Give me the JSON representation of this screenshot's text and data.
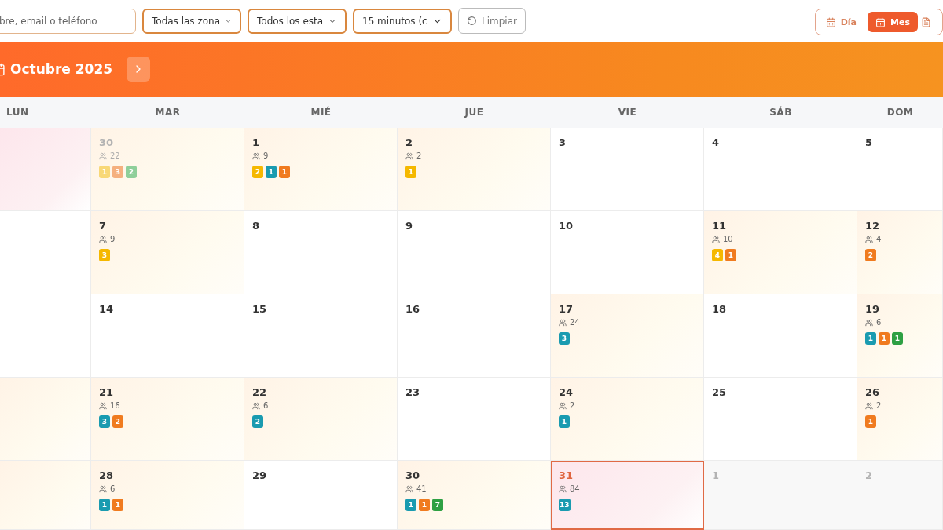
{
  "toolbar": {
    "search": {
      "placeholder": "bre, email o teléfono"
    },
    "selects": [
      {
        "value": "Todas las zona"
      },
      {
        "value": "Todos los esta"
      },
      {
        "value": "15 minutos (c"
      }
    ],
    "clear_button": "Limpiar",
    "views": [
      {
        "label": "Día",
        "selected": false
      },
      {
        "label": "Mes",
        "selected": true
      }
    ]
  },
  "month": {
    "title": "Octubre 2025"
  },
  "weekdays": [
    "LUN",
    "MAR",
    "MIÉ",
    "JUE",
    "VIE",
    "SÁB",
    "DOM"
  ],
  "weeks": [
    {
      "days": [
        {
          "kind": "pink"
        },
        {
          "day": "30",
          "outside": true,
          "kind": "warm",
          "count": "22",
          "badges": [
            {
              "n": "1",
              "color": "#f8d877"
            },
            {
              "n": "3",
              "color": "#f5b07f"
            },
            {
              "n": "2",
              "color": "#8fcf9a"
            }
          ]
        },
        {
          "day": "1",
          "kind": "warm",
          "count": "9",
          "badges": [
            {
              "n": "2",
              "color": "#f5b800"
            },
            {
              "n": "1",
              "color": "#1a9bb0"
            },
            {
              "n": "1",
              "color": "#f07b1f"
            }
          ]
        },
        {
          "day": "2",
          "kind": "warm",
          "count": "2",
          "badges": [
            {
              "n": "1",
              "color": "#f5b800"
            }
          ]
        },
        {
          "day": "3",
          "kind": "plain"
        },
        {
          "day": "4",
          "kind": "plain"
        },
        {
          "day": "5",
          "kind": "plain"
        }
      ]
    },
    {
      "days": [
        {
          "kind": "plain"
        },
        {
          "day": "7",
          "kind": "warm",
          "count": "9",
          "badges": [
            {
              "n": "3",
              "color": "#f5b800"
            }
          ]
        },
        {
          "day": "8",
          "kind": "plain"
        },
        {
          "day": "9",
          "kind": "plain"
        },
        {
          "day": "10",
          "kind": "plain"
        },
        {
          "day": "11",
          "kind": "warm",
          "count": "10",
          "badges": [
            {
              "n": "4",
              "color": "#f5b800"
            },
            {
              "n": "1",
              "color": "#f07b1f"
            }
          ]
        },
        {
          "day": "12",
          "kind": "warm",
          "count": "4",
          "badges": [
            {
              "n": "2",
              "color": "#f07b1f"
            }
          ]
        }
      ]
    },
    {
      "days": [
        {
          "kind": "plain"
        },
        {
          "day": "14",
          "kind": "plain"
        },
        {
          "day": "15",
          "kind": "plain"
        },
        {
          "day": "16",
          "kind": "plain"
        },
        {
          "day": "17",
          "kind": "warm",
          "count": "24",
          "badges": [
            {
              "n": "3",
              "color": "#1a9bb0"
            }
          ]
        },
        {
          "day": "18",
          "kind": "plain"
        },
        {
          "day": "19",
          "kind": "warm",
          "count": "6",
          "badges": [
            {
              "n": "1",
              "color": "#1a9bb0"
            },
            {
              "n": "1",
              "color": "#f07b1f"
            },
            {
              "n": "1",
              "color": "#2ea043"
            }
          ]
        }
      ]
    },
    {
      "days": [
        {
          "kind": "warm"
        },
        {
          "day": "21",
          "kind": "warm",
          "count": "16",
          "badges": [
            {
              "n": "3",
              "color": "#1a9bb0"
            },
            {
              "n": "2",
              "color": "#f07b1f"
            }
          ]
        },
        {
          "day": "22",
          "kind": "warm",
          "count": "6",
          "badges": [
            {
              "n": "2",
              "color": "#1a9bb0"
            }
          ]
        },
        {
          "day": "23",
          "kind": "plain"
        },
        {
          "day": "24",
          "kind": "warm",
          "count": "2",
          "badges": [
            {
              "n": "1",
              "color": "#1a9bb0"
            }
          ]
        },
        {
          "day": "25",
          "kind": "plain"
        },
        {
          "day": "26",
          "kind": "warm",
          "count": "2",
          "badges": [
            {
              "n": "1",
              "color": "#f07b1f"
            }
          ]
        }
      ]
    },
    {
      "days": [
        {
          "kind": "warm"
        },
        {
          "day": "28",
          "kind": "warm",
          "count": "6",
          "badges": [
            {
              "n": "1",
              "color": "#1a9bb0"
            },
            {
              "n": "1",
              "color": "#f07b1f"
            }
          ]
        },
        {
          "day": "29",
          "kind": "plain"
        },
        {
          "day": "30",
          "kind": "warm",
          "count": "41",
          "badges": [
            {
              "n": "1",
              "color": "#1a9bb0"
            },
            {
              "n": "1",
              "color": "#f07b1f"
            },
            {
              "n": "7",
              "color": "#2ea043"
            }
          ]
        },
        {
          "day": "31",
          "today": true,
          "kind": "pink",
          "count": "84",
          "badges": [
            {
              "n": "13",
              "color": "#1a9bb0"
            }
          ]
        },
        {
          "day": "1",
          "outside": true,
          "kind": "muted"
        },
        {
          "day": "2",
          "outside": true,
          "kind": "muted"
        }
      ]
    }
  ]
}
